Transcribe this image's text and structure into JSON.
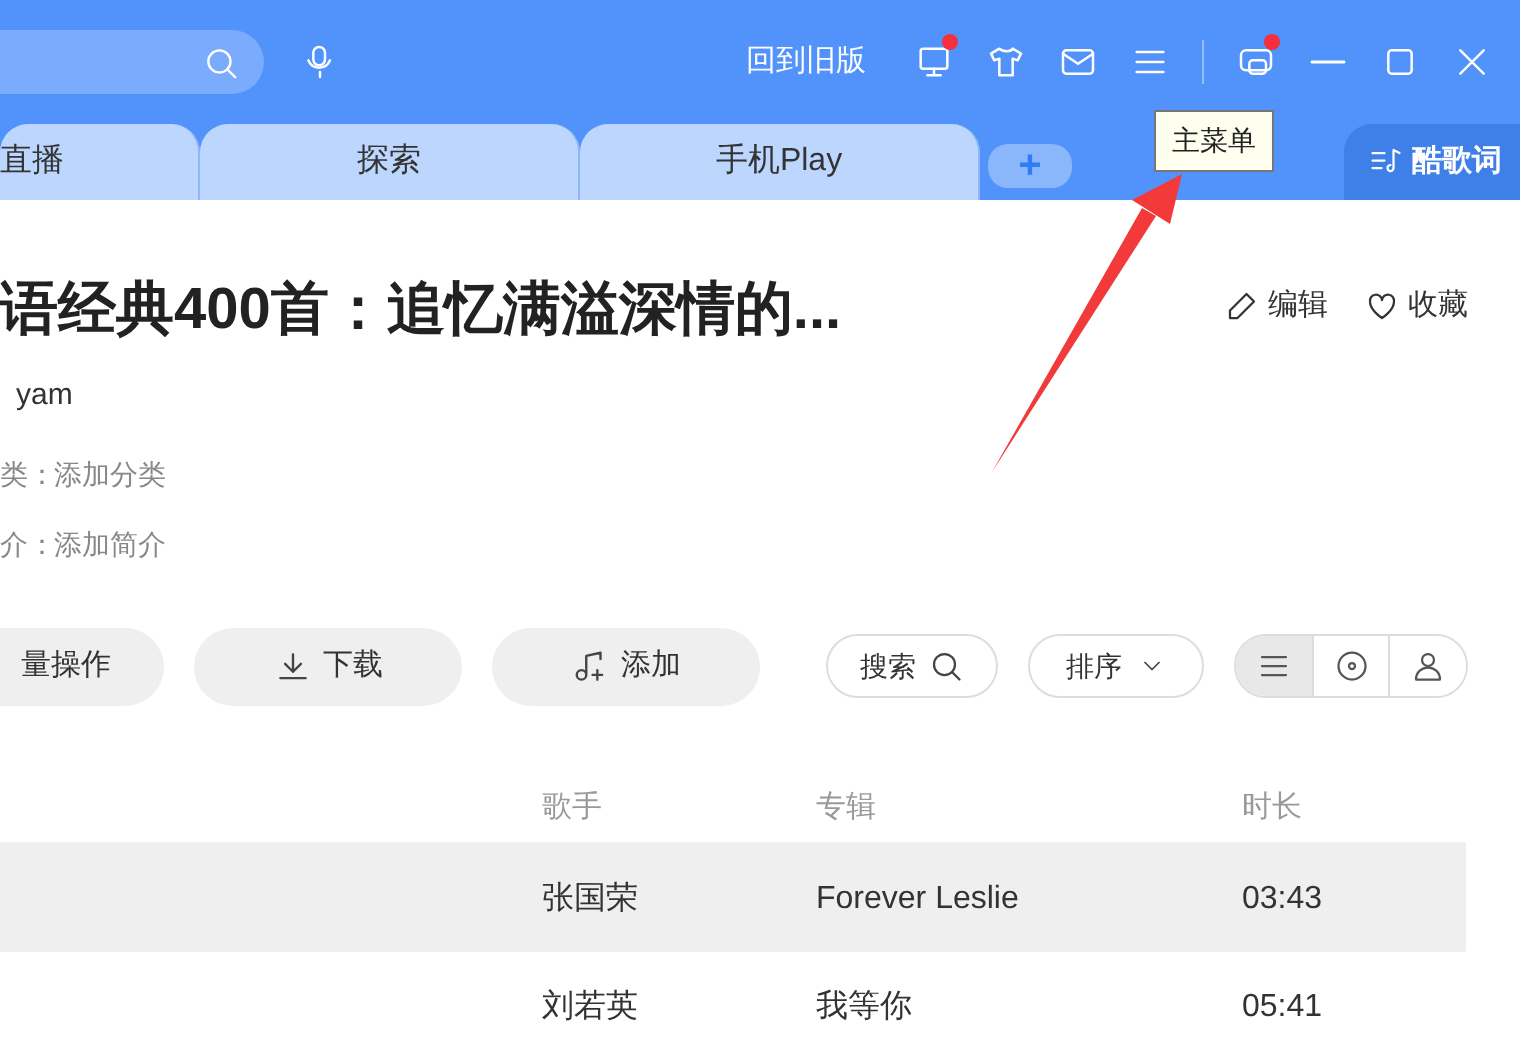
{
  "top_bar": {
    "old_version_link": "回到旧版",
    "icons": [
      {
        "kind": "monitor",
        "badge": true
      },
      {
        "kind": "shirt",
        "badge": false
      },
      {
        "kind": "mail",
        "badge": false
      },
      {
        "kind": "menu",
        "badge": false
      }
    ],
    "window_icons": [
      {
        "kind": "mini",
        "badge": true
      },
      {
        "kind": "minimize",
        "badge": false
      },
      {
        "kind": "maximize",
        "badge": false
      },
      {
        "kind": "close",
        "badge": false
      }
    ]
  },
  "tooltip": "主菜单",
  "tabs": [
    {
      "label": "直播"
    },
    {
      "label": "探索"
    },
    {
      "label": "手机Play"
    }
  ],
  "add_tab": "+",
  "lyrics_tab": "酷歌词",
  "playlist": {
    "title": "语经典400首：追忆满溢深情的...",
    "creator": "yam",
    "category_label": "类：",
    "category_value": "添加分类",
    "intro_label": "介：",
    "intro_value": "添加简介",
    "actions": [
      {
        "kind": "edit",
        "label": "编辑"
      },
      {
        "kind": "favorite",
        "label": "收藏"
      }
    ]
  },
  "toolbar": {
    "buttons": [
      {
        "kind": "batch",
        "label": "量操作"
      },
      {
        "kind": "download",
        "label": "下载"
      },
      {
        "kind": "add",
        "label": "添加"
      }
    ],
    "search": "搜索",
    "sort": "排序",
    "views": [
      {
        "kind": "list",
        "selected": true
      },
      {
        "kind": "disc",
        "selected": false
      },
      {
        "kind": "artist",
        "selected": false
      }
    ]
  },
  "table": {
    "columns": [
      "歌手",
      "专辑",
      "时长"
    ],
    "rows": [
      {
        "cells": [
          "张国荣",
          "Forever Leslie",
          "03:43"
        ],
        "highlighted": true
      },
      {
        "cells": [
          "刘若英",
          "我等你",
          "05:41"
        ],
        "highlighted": false
      }
    ]
  }
}
